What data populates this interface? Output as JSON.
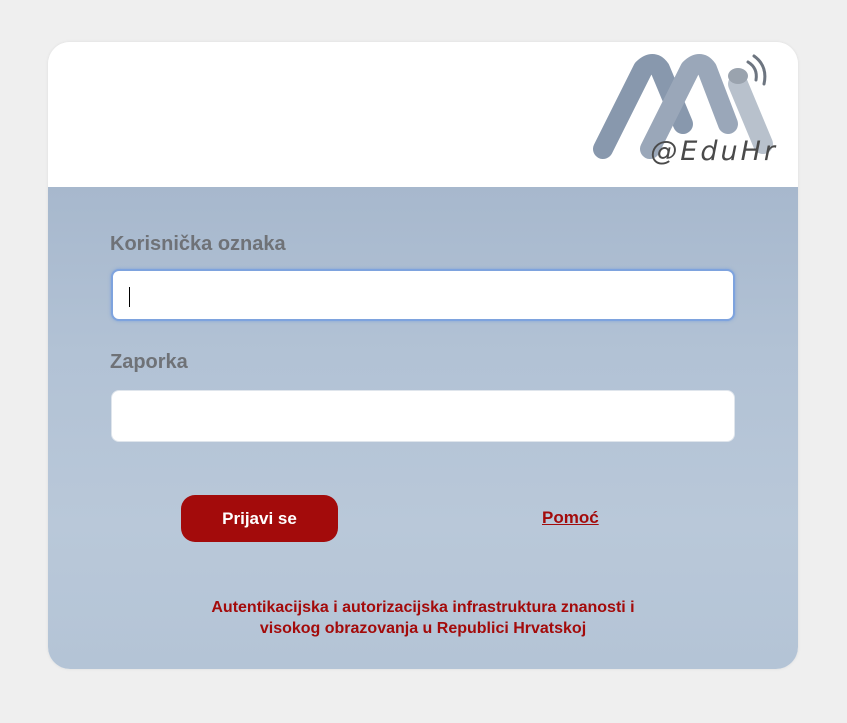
{
  "logo": {
    "icon": "aai-logo-icon",
    "text": "@EduHr"
  },
  "form": {
    "username_label": "Korisnička oznaka",
    "username_value": "",
    "password_label": "Zaporka",
    "password_value": "",
    "login_button": "Prijavi se",
    "help_link": "Pomoć"
  },
  "footer": {
    "line1": "Autentikacijska i autorizacijska infrastruktura znanosti i",
    "line2": "visokog obrazovanja u Republici Hrvatskoj"
  },
  "colors": {
    "accent": "#a30b0b",
    "panel": "#b2c2d5",
    "page_background": "#efefef"
  }
}
